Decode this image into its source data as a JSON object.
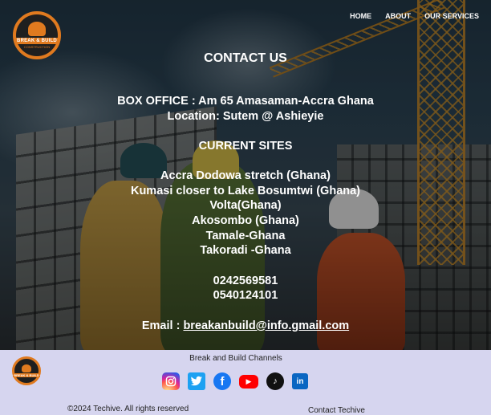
{
  "nav": {
    "brand": "BREAK & BUILD",
    "brand_sub": "CONSTRUCTION",
    "links": [
      "HOME",
      "ABOUT",
      "OUR SERVICES"
    ]
  },
  "contact": {
    "title": "CONTACT US",
    "box_office": "BOX OFFICE : Am 65 Amasaman-Accra Ghana",
    "location": "Location: Sutem @ Ashieyie",
    "sites_heading": "CURRENT SITES",
    "sites": [
      "Accra Dodowa stretch (Ghana)",
      "Kumasi closer to Lake Bosumtwi (Ghana)",
      "Volta(Ghana)",
      "Akosombo (Ghana)",
      "Tamale-Ghana",
      "Takoradi -Ghana"
    ],
    "phones": [
      "0242569581",
      "0540124101"
    ],
    "email_label": "Email : ",
    "email": "breakanbuild@info.gmail.com"
  },
  "footer": {
    "channels_title": "Break and Build Channels",
    "socials": [
      "instagram-icon",
      "twitter-icon",
      "facebook-icon",
      "youtube-icon",
      "tiktok-icon",
      "linkedin-icon"
    ],
    "copyright": "©2024 Techive. All rights reserved",
    "contact_link": "Contact Techive"
  },
  "colors": {
    "brand_orange": "#e07a1f",
    "footer_bg": "#d6d5ef"
  }
}
